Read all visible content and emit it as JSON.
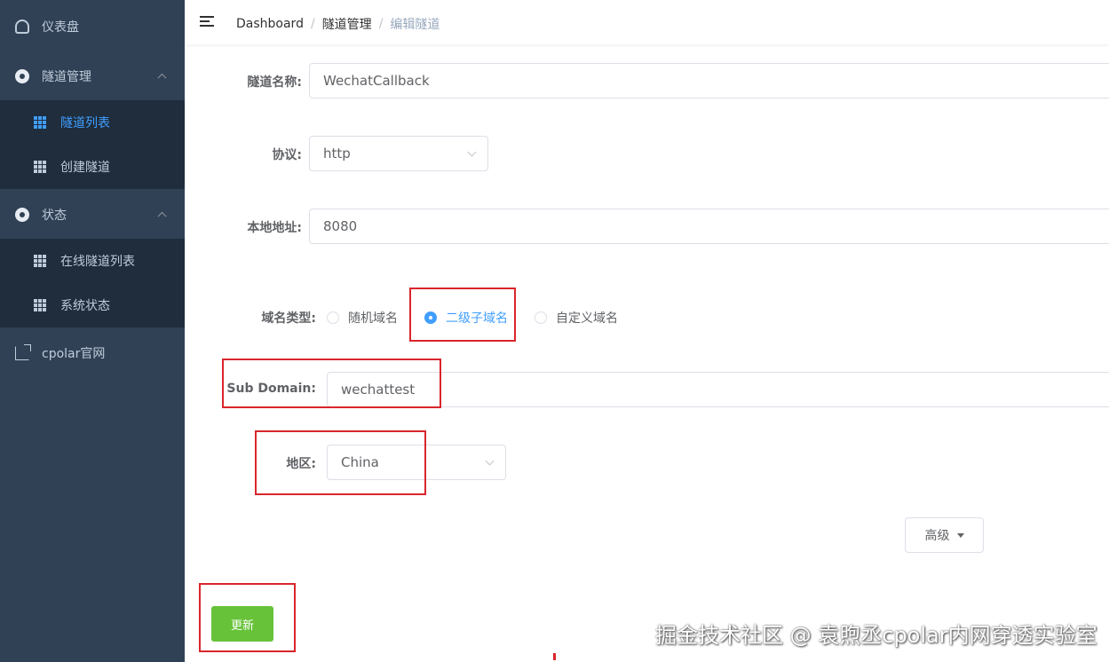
{
  "sidebar": {
    "items": [
      {
        "label": "仪表盘",
        "icon": "dashboard-icon"
      },
      {
        "label": "隧道管理",
        "icon": "circle-icon",
        "expanded": true,
        "children": [
          {
            "label": "隧道列表",
            "active": true
          },
          {
            "label": "创建隧道"
          }
        ]
      },
      {
        "label": "状态",
        "icon": "circle-icon",
        "expanded": true,
        "children": [
          {
            "label": "在线隧道列表"
          },
          {
            "label": "系统状态"
          }
        ]
      },
      {
        "label": "cpolar官网",
        "icon": "external-link-icon"
      }
    ]
  },
  "breadcrumb": [
    "Dashboard",
    "隧道管理",
    "编辑隧道"
  ],
  "form": {
    "name_label": "隧道名称:",
    "name_value": "WechatCallback",
    "protocol_label": "协议:",
    "protocol_value": "http",
    "local_label": "本地地址:",
    "local_value": "8080",
    "domain_type_label": "域名类型:",
    "domain_options": [
      "随机域名",
      "二级子域名",
      "自定义域名"
    ],
    "domain_selected": "二级子域名",
    "subdomain_label": "Sub Domain:",
    "subdomain_value": "wechattest",
    "region_label": "地区:",
    "region_value": "China",
    "advanced_label": "高级",
    "submit_label": "更新"
  },
  "watermark": "掘金技术社区 @ 袁煦丞cpolar内网穿透实验室",
  "colors": {
    "sidebar_bg": "#304156",
    "submenu_bg": "#1f2d3d",
    "accent": "#409eff",
    "submit": "#67c23a",
    "highlight": "#d9262c"
  }
}
